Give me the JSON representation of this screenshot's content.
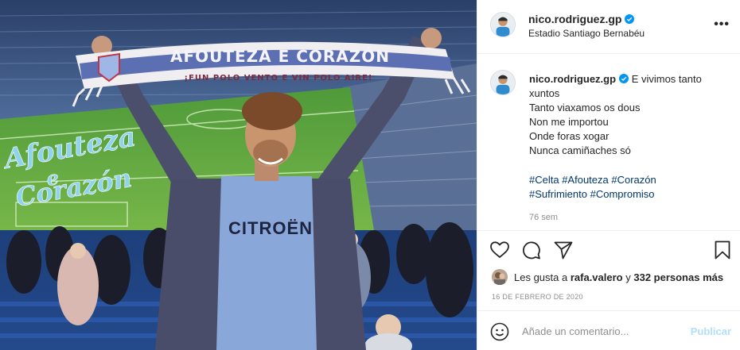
{
  "post": {
    "username": "nico.rodriguez.gp",
    "location": "Estadio Santiago Bernabéu",
    "more_icon": "ellipsis-icon",
    "verified_icon": "verified-badge-icon",
    "accent_color": "#0095f6"
  },
  "photo": {
    "scarf_top_text": "AFOUTEZA E CORAZÓN",
    "scarf_bottom_text": "¡FUN POLO VENTO E VIN POLO AIRE!",
    "overlay_text_line1": "Afouteza",
    "overlay_text_line2": "e",
    "overlay_text_line3": "Corazón",
    "shirt_text": "CITROËN",
    "overlay_color": "#8fd3ee"
  },
  "caption": {
    "username": "nico.rodriguez.gp",
    "lines": [
      "E vivimos tanto xuntos",
      "Tanto viaxamos os dous",
      "Non me importou",
      "Onde foras xogar",
      "Nunca camiñaches só"
    ],
    "hashtags": [
      "#Celta",
      "#Afouteza",
      "#Corazón",
      "#Sufrimiento",
      "#Compromiso"
    ],
    "time_ago": "76 sem"
  },
  "actions": {
    "like_icon": "heart-icon",
    "comment_icon": "comment-bubble-icon",
    "share_icon": "paper-plane-icon",
    "save_icon": "bookmark-icon"
  },
  "likes": {
    "prefix": "Les gusta a",
    "user": "rafa.valero",
    "connector": "y",
    "others": "332 personas más"
  },
  "date": "16 DE FEBRERO DE 2020",
  "comment": {
    "emoji_icon": "smiley-icon",
    "placeholder": "Añade un comentario...",
    "publish_label": "Publicar",
    "publish_color": "#b2dffc"
  }
}
